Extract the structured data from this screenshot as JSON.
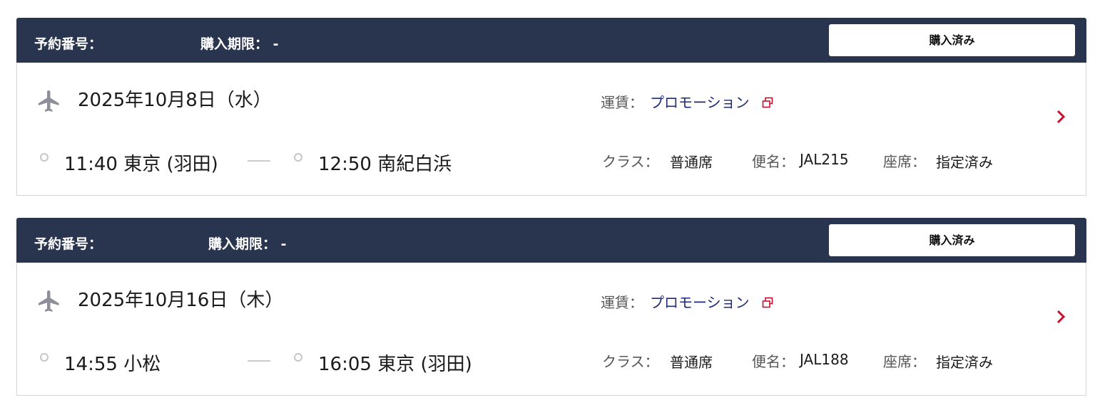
{
  "bookings": [
    {
      "reservation_label": "予約番号：",
      "limit_label": "購入期限：",
      "limit_value": "-",
      "status": "購入済み",
      "date": "2025年10月8日（水）",
      "fare_label": "運賃：",
      "fare": "プロモーション",
      "depart": "11:40 東京 (羽田)",
      "arrive": "12:50 南紀白浜",
      "class_label": "クラス：",
      "class_value": "普通席",
      "flight_label": "便名：",
      "flight_value": "JAL215",
      "seat_label": "座席：",
      "seat_value": "指定済み"
    },
    {
      "reservation_label": "予約番号：",
      "limit_label": "購入期限：",
      "limit_value": "-",
      "status": "購入済み",
      "date": "2025年10月16日（木）",
      "fare_label": "運賃：",
      "fare": "プロモーション",
      "depart": "14:55 小松",
      "arrive": "16:05 東京 (羽田)",
      "class_label": "クラス：",
      "class_value": "普通席",
      "flight_label": "便名：",
      "flight_value": "JAL188",
      "seat_label": "座席：",
      "seat_value": "指定済み"
    }
  ],
  "colors": {
    "header_bg": "#29344f",
    "link": "#1e2a78",
    "accent_red": "#c8102e",
    "icon_gray": "#8c8f99"
  },
  "icons": [
    "airplane-icon",
    "external-link-icon",
    "chevron-right-icon",
    "circle-marker-icon"
  ]
}
